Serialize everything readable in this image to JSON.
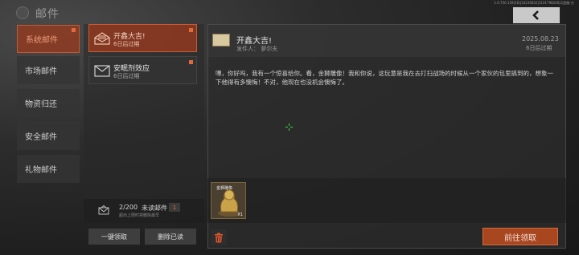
{
  "header": {
    "title": "邮件",
    "build_info": "1.0.750.159(16)|34230632|1101798260|2|国服-台",
    "back_icon": "chevron-left-icon"
  },
  "categories": [
    {
      "label": "系统邮件",
      "active": true,
      "has_unread": true
    },
    {
      "label": "市场邮件",
      "active": false,
      "has_unread": false
    },
    {
      "label": "物资归还",
      "active": false,
      "has_unread": false
    },
    {
      "label": "安全邮件",
      "active": false,
      "has_unread": false
    },
    {
      "label": "礼物邮件",
      "active": false,
      "has_unread": false
    }
  ],
  "mail_list": [
    {
      "title": "开鑫大吉!",
      "expire": "6日后过期",
      "active": true,
      "icon": "open-envelope-icon",
      "unread": true
    },
    {
      "title": "安眠剂效应",
      "expire": "6日后过期",
      "active": false,
      "icon": "envelope-icon",
      "unread": true
    }
  ],
  "mailbox": {
    "count": "2/200",
    "unread_label": "未读邮件",
    "unread_count": "1",
    "hint": "超出上限时将删除最早",
    "claim_all_label": "一键领取",
    "delete_read_label": "删除已读"
  },
  "detail": {
    "title": "开鑫大吉!",
    "sender": "发件人：  萝尔夫",
    "date": "2025.08.23",
    "expire": "6日后过期",
    "body": "嘿，你好吗，我有一个惊喜给你。看，金狮雕像！我和你说，这玩意是我在去打扫战场的时候从一个家伙的包里搞到的，想象一下他得有多懊悔！不对，他现在也没机会懊悔了。",
    "attachment": {
      "name": "金狮雕像",
      "quantity": "X1"
    },
    "claim_label": "前往领取"
  },
  "colors": {
    "accent": "#a8461f",
    "accent_border": "#c75c34",
    "unread_dot": "#e06a3a",
    "crosshair": "#39c24a"
  }
}
